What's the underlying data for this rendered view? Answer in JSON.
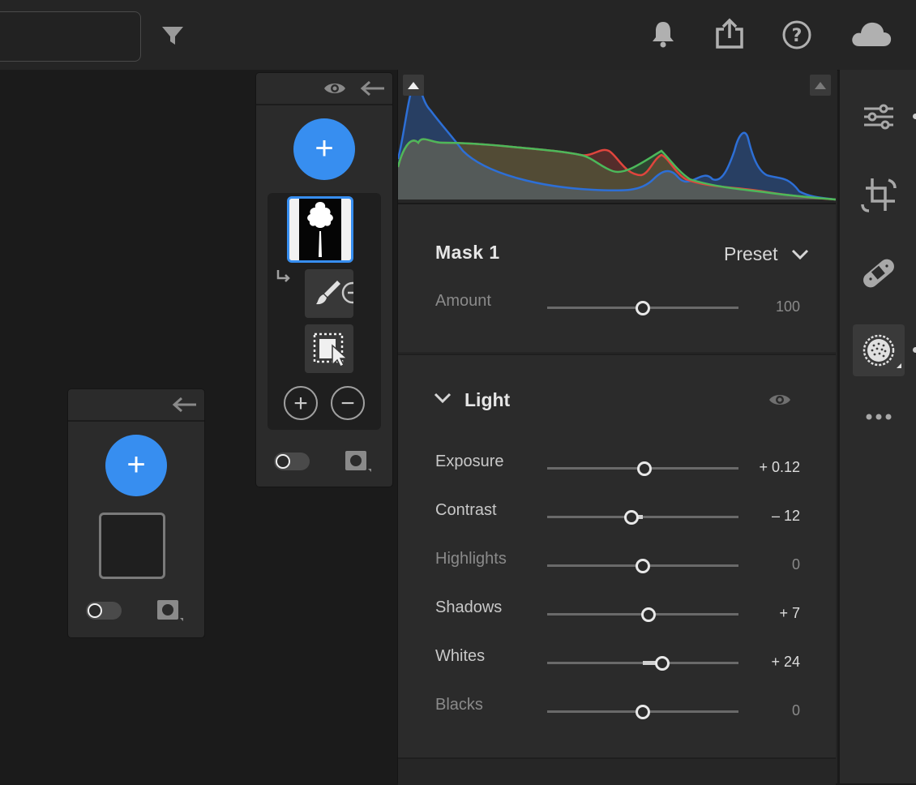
{
  "colors": {
    "accent": "#378ef0",
    "panel": "#2b2b2b",
    "background": "#1b1b1b",
    "histogram_red": "#e0453d",
    "histogram_green": "#4cb85a",
    "histogram_blue": "#2d6fd6"
  },
  "toolbar": {
    "icons": [
      "filter-icon",
      "bell-icon",
      "share-icon",
      "help-icon",
      "cloud-icon"
    ]
  },
  "masks_panel": {
    "add_label": "+",
    "add_brush_label": "+",
    "subtract_brush_label": "−"
  },
  "new_mask_panel": {
    "add_label": "+"
  },
  "mask_settings": {
    "title": "Mask 1",
    "preset_label": "Preset",
    "amount": {
      "label": "Amount",
      "value": "100",
      "level": 0.5
    }
  },
  "light": {
    "title": "Light",
    "rows": [
      {
        "label": "Exposure",
        "value": "+ 0.12",
        "level": 0.51
      },
      {
        "label": "Contrast",
        "value": "– 12",
        "level": 0.44
      },
      {
        "label": "Highlights",
        "value": "0",
        "level": 0.5
      },
      {
        "label": "Shadows",
        "value": "+ 7",
        "level": 0.53
      },
      {
        "label": "Whites",
        "value": "+ 24",
        "level": 0.6
      },
      {
        "label": "Blacks",
        "value": "0",
        "level": 0.5
      }
    ]
  },
  "side_toolbar": {
    "icons": [
      "edit-sliders-icon",
      "crop-icon",
      "healing-icon",
      "masking-icon",
      "more-icon"
    ],
    "active": "masking-icon"
  }
}
